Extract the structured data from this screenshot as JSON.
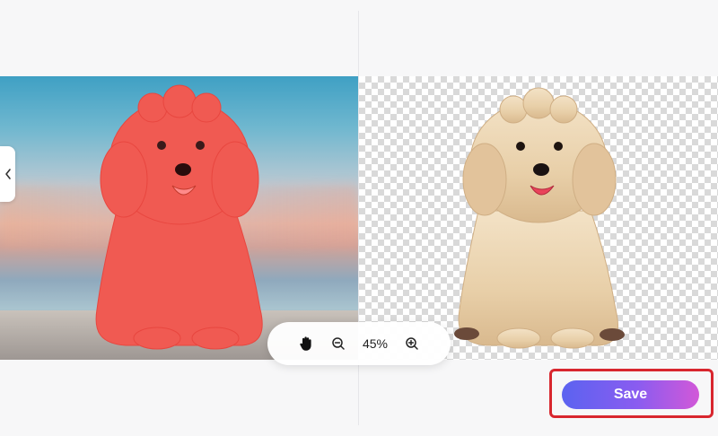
{
  "toolbar": {
    "zoom_level": "45%",
    "pan_icon": "hand-icon",
    "zoom_out_icon": "zoom-out-icon",
    "zoom_in_icon": "zoom-in-icon"
  },
  "collapse": {
    "icon": "chevron-left-icon"
  },
  "actions": {
    "save_label": "Save"
  },
  "colors": {
    "mask_red": "#f05a52",
    "save_gradient_start": "#5b63f0",
    "save_gradient_end": "#d258d8",
    "highlight_border": "#d8262e"
  }
}
